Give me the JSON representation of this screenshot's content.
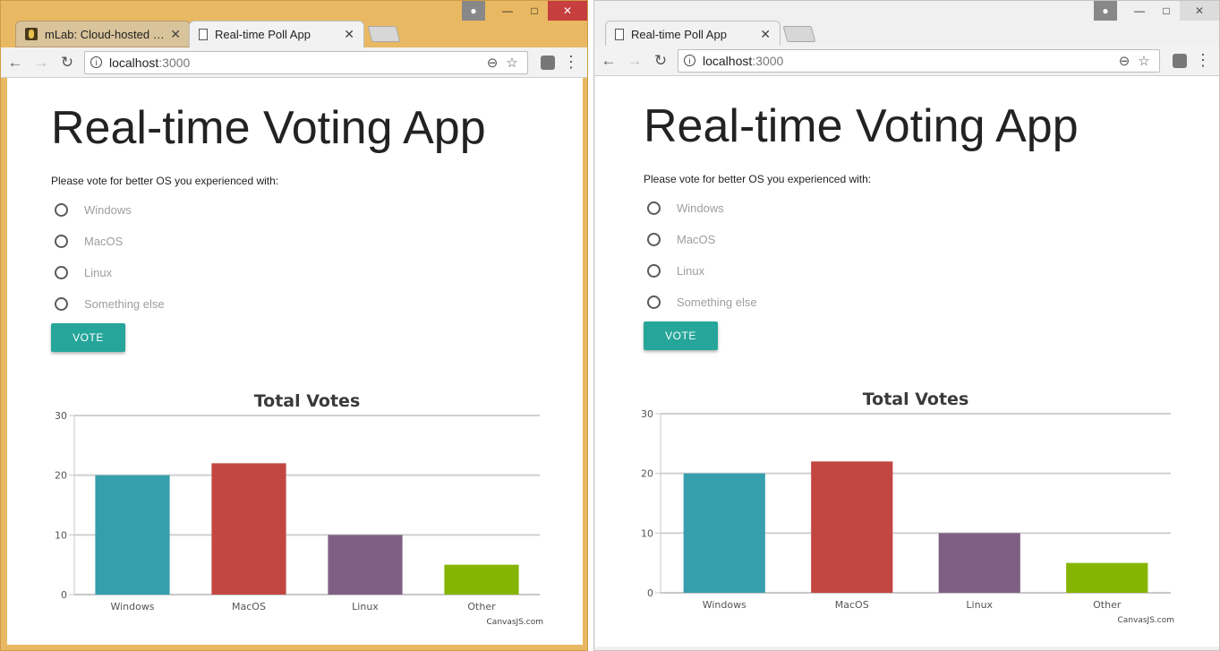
{
  "windows": [
    {
      "tabs": [
        {
          "title": "mLab: Cloud-hosted Mo",
          "icon": "mlab-icon"
        },
        {
          "title": "Real-time Poll App",
          "icon": "page-icon"
        }
      ],
      "address": {
        "host": "localhost",
        "port": ":3000"
      },
      "app": {
        "title": "Real-time Voting App",
        "prompt": "Please vote for better OS you experienced with:",
        "options": [
          "Windows",
          "MacOS",
          "Linux",
          "Something else"
        ],
        "vote_button": "VOTE"
      },
      "chart_data": {
        "type": "bar",
        "title": "Total Votes",
        "categories": [
          "Windows",
          "MacOS",
          "Linux",
          "Other"
        ],
        "values": [
          20,
          22,
          10,
          5
        ],
        "colors": [
          "#369ead",
          "#c24642",
          "#7f6084",
          "#86b402"
        ],
        "ylim": [
          0,
          30
        ],
        "yticks": [
          0,
          10,
          20,
          30
        ],
        "grid": true,
        "credit": "CanvasJS.com"
      }
    },
    {
      "tabs": [
        {
          "title": "Real-time Poll App",
          "icon": "page-icon"
        }
      ],
      "address": {
        "host": "localhost",
        "port": ":3000"
      },
      "app": {
        "title": "Real-time Voting App",
        "prompt": "Please vote for better OS you experienced with:",
        "options": [
          "Windows",
          "MacOS",
          "Linux",
          "Something else"
        ],
        "vote_button": "VOTE"
      },
      "chart_data": {
        "type": "bar",
        "title": "Total Votes",
        "categories": [
          "Windows",
          "MacOS",
          "Linux",
          "Other"
        ],
        "values": [
          20,
          22,
          10,
          5
        ],
        "colors": [
          "#369ead",
          "#c24642",
          "#7f6084",
          "#86b402"
        ],
        "ylim": [
          0,
          30
        ],
        "yticks": [
          0,
          10,
          20,
          30
        ],
        "grid": true,
        "credit": "CanvasJS.com"
      }
    }
  ]
}
